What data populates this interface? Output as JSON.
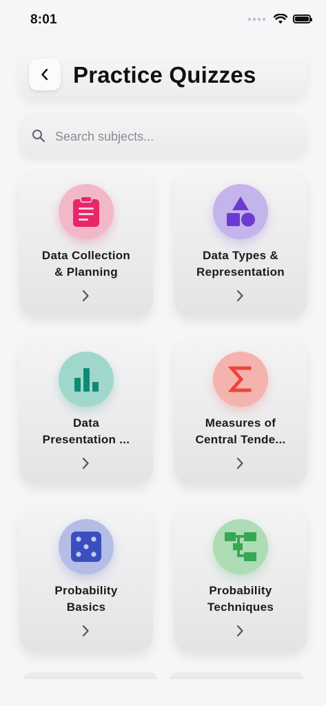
{
  "status_bar": {
    "time": "8:01"
  },
  "header": {
    "title": "Practice Quizzes"
  },
  "search": {
    "placeholder": "Search subjects..."
  },
  "colors": {
    "pink": "#e8266a",
    "purple": "#6b3ad1",
    "teal": "#0f8a78",
    "red": "#f0433b",
    "blue": "#3a4fbf",
    "green": "#34a853"
  },
  "cards": [
    {
      "title": "Data Collection\n& Planning",
      "icon": "clipboard-icon"
    },
    {
      "title": "Data Types &\nRepresentation",
      "icon": "shapes-icon"
    },
    {
      "title": "Data\nPresentation ...",
      "icon": "bar-chart-icon"
    },
    {
      "title": "Measures of\nCentral Tende...",
      "icon": "sigma-icon"
    },
    {
      "title": "Probability\nBasics",
      "icon": "dice-icon"
    },
    {
      "title": "Probability\nTechniques",
      "icon": "tree-diagram-icon"
    }
  ]
}
